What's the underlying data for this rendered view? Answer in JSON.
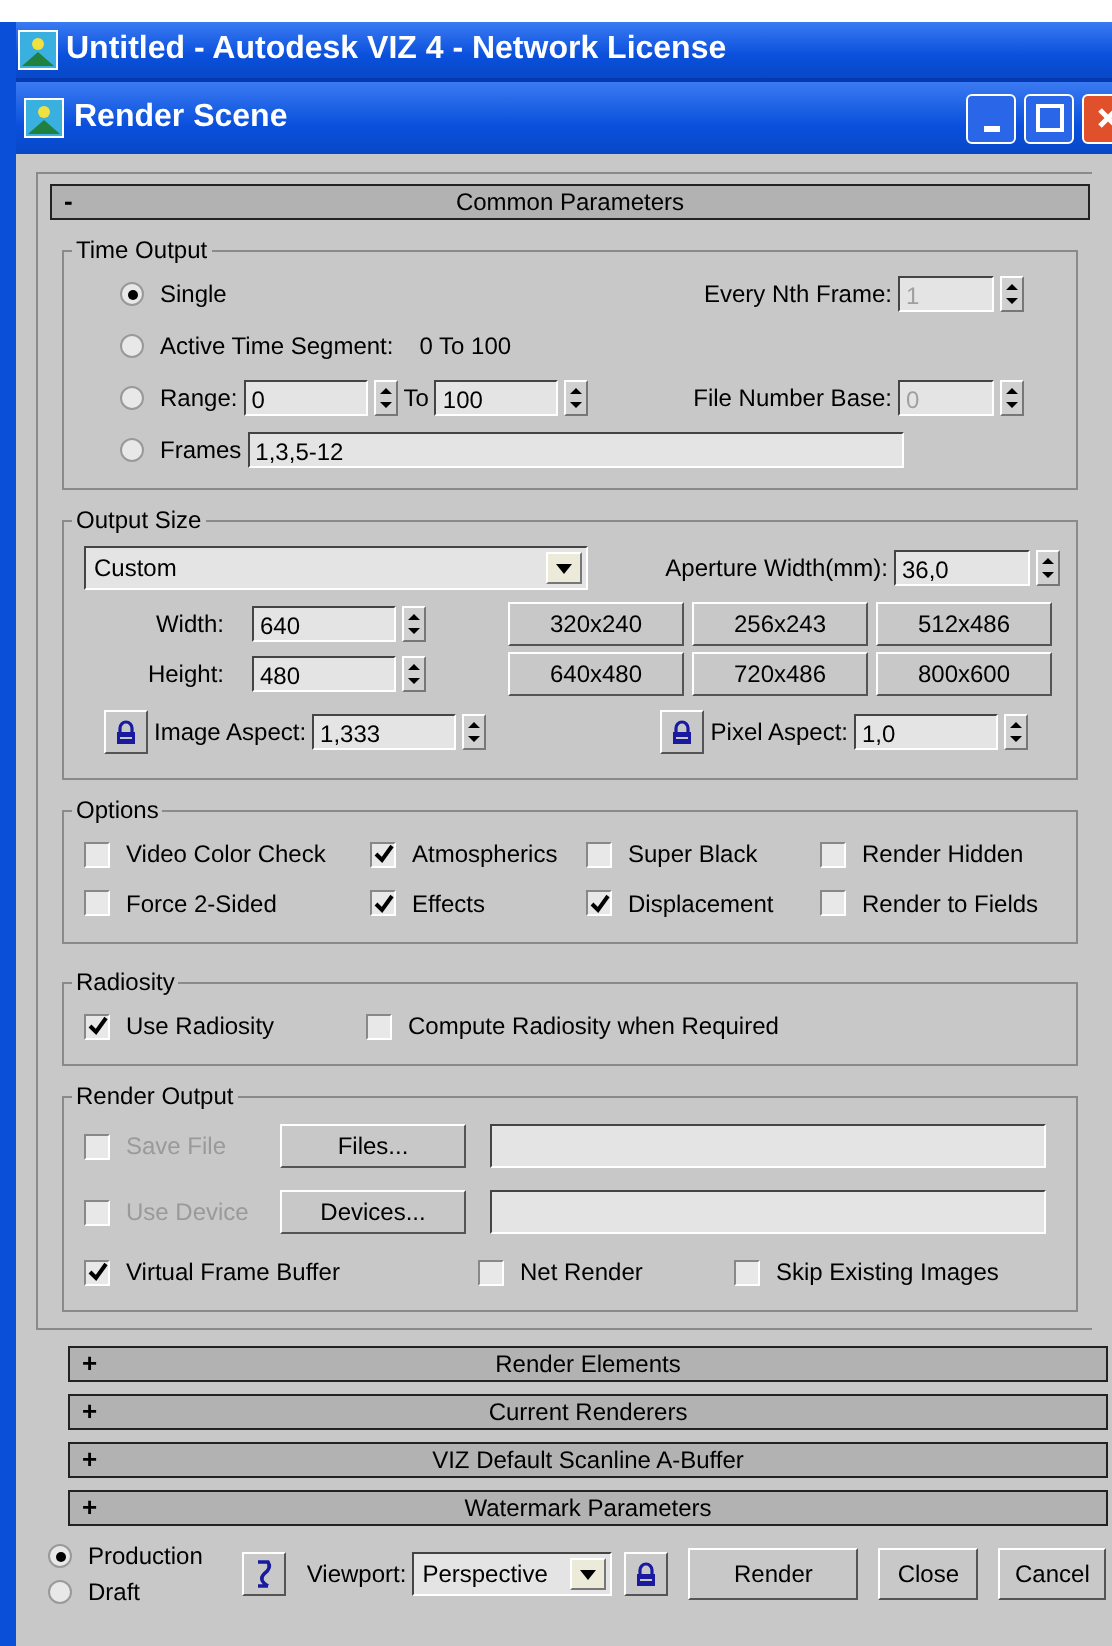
{
  "window": {
    "title": "Untitled - Autodesk VIZ 4 - Network License"
  },
  "dialog": {
    "title": "Render Scene"
  },
  "common_rollout": {
    "sign": "-",
    "title": "Common Parameters"
  },
  "time_output": {
    "title": "Time Output",
    "modes": [
      {
        "label": "Single",
        "selected": true
      },
      {
        "label": "Active Time Segment:",
        "selected": false
      },
      {
        "label": "Range:",
        "selected": false
      },
      {
        "label": "Frames",
        "selected": false
      }
    ],
    "active_segment": "0 To 100",
    "range_from": "0",
    "range_to_label": "To",
    "range_to": "100",
    "frames": "1,3,5-12",
    "every_nth": {
      "label": "Every Nth Frame:",
      "value": "1",
      "disabled": true
    },
    "file_number_base": {
      "label": "File Number Base:",
      "value": "0",
      "disabled": true
    }
  },
  "output_size": {
    "title": "Output Size",
    "preset": "Custom",
    "aperture": {
      "label": "Aperture Width(mm):",
      "value": "36,0"
    },
    "width": {
      "label": "Width:",
      "value": "640"
    },
    "height": {
      "label": "Height:",
      "value": "480"
    },
    "presets": [
      "320x240",
      "256x243",
      "512x486",
      "640x480",
      "720x486",
      "800x600"
    ],
    "image_aspect": {
      "label": "Image Aspect:",
      "value": "1,333"
    },
    "pixel_aspect": {
      "label": "Pixel Aspect:",
      "value": "1,0"
    }
  },
  "options": {
    "title": "Options",
    "items": [
      {
        "label": "Video Color Check",
        "checked": false
      },
      {
        "label": "Atmospherics",
        "checked": true
      },
      {
        "label": "Super Black",
        "checked": false
      },
      {
        "label": "Render Hidden",
        "checked": false
      },
      {
        "label": "Force 2-Sided",
        "checked": false
      },
      {
        "label": "Effects",
        "checked": true
      },
      {
        "label": "Displacement",
        "checked": true
      },
      {
        "label": "Render to Fields",
        "checked": false
      }
    ]
  },
  "radiosity": {
    "title": "Radiosity",
    "items": [
      {
        "label": "Use Radiosity",
        "checked": true
      },
      {
        "label": "Compute Radiosity when Required",
        "checked": false
      }
    ]
  },
  "render_output": {
    "title": "Render Output",
    "save_file": {
      "label": "Save File",
      "checked": false,
      "disabled": true
    },
    "files_button": "Files...",
    "use_device": {
      "label": "Use Device",
      "checked": false,
      "disabled": true
    },
    "devices_button": "Devices...",
    "items": [
      {
        "label": "Virtual Frame Buffer",
        "checked": true
      },
      {
        "label": "Net Render",
        "checked": false
      },
      {
        "label": "Skip Existing Images",
        "checked": false
      }
    ]
  },
  "rollouts": [
    {
      "sign": "+",
      "title": "Render Elements"
    },
    {
      "sign": "+",
      "title": "Current Renderers"
    },
    {
      "sign": "+",
      "title": "VIZ Default Scanline A-Buffer"
    },
    {
      "sign": "+",
      "title": "Watermark Parameters"
    }
  ],
  "bottom": {
    "modes": [
      {
        "label": "Production",
        "selected": true
      },
      {
        "label": "Draft",
        "selected": false
      }
    ],
    "viewport_label": "Viewport:",
    "viewport": "Perspective",
    "buttons": [
      "Render",
      "Close",
      "Cancel"
    ]
  }
}
